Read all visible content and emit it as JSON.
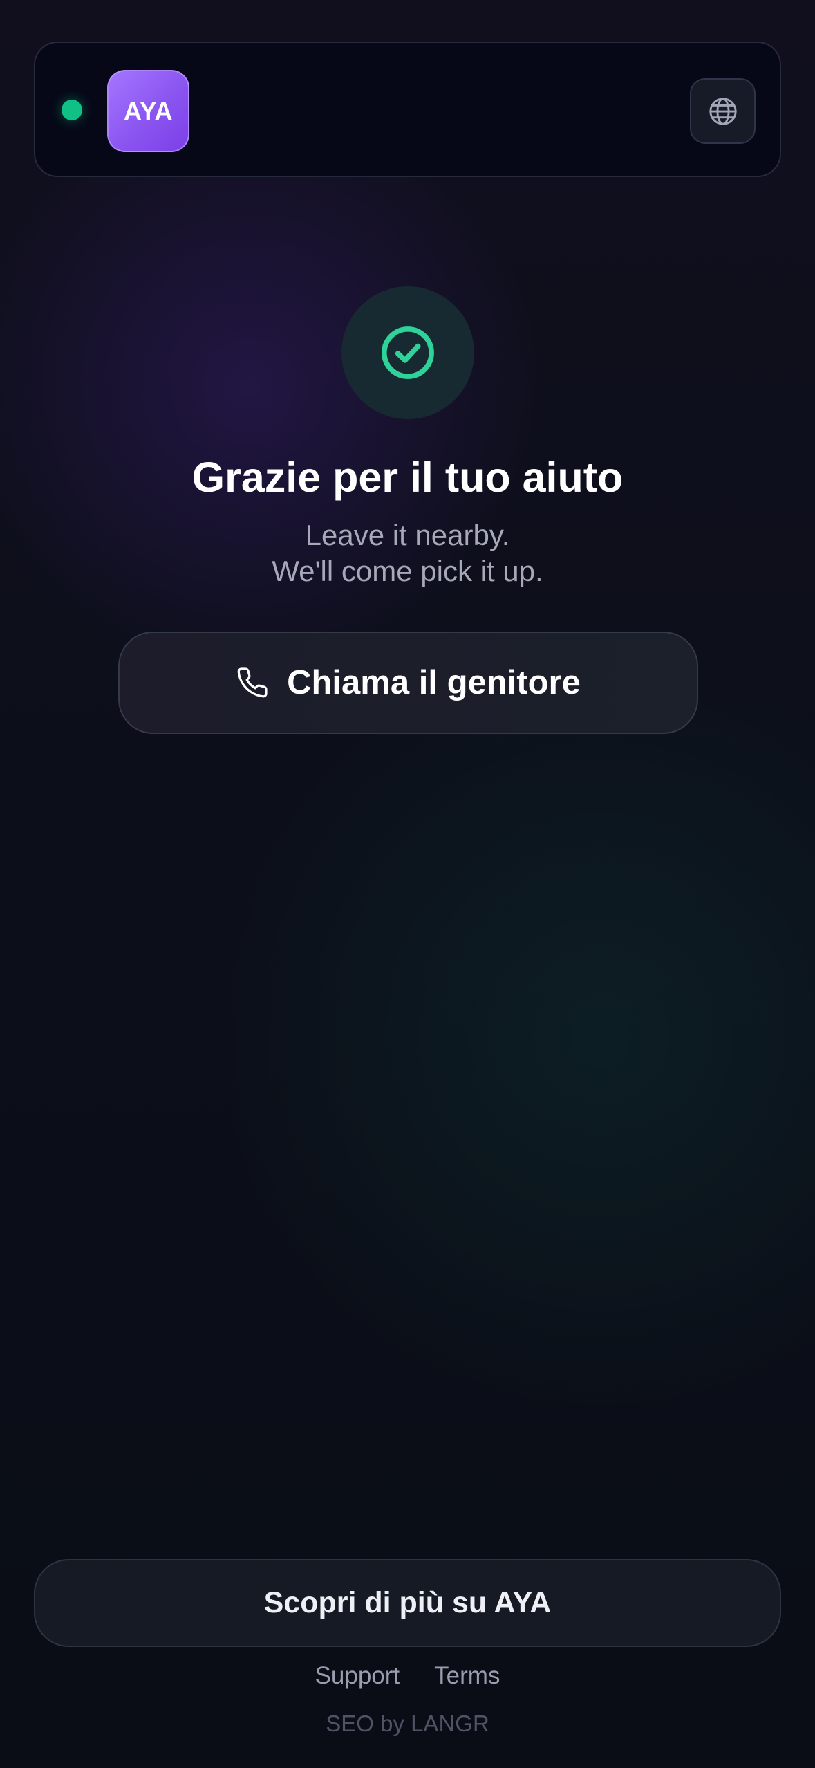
{
  "colors": {
    "accent_purple": "#8b55f0",
    "status_green": "#10c186",
    "background": "#0c0f1a"
  },
  "header": {
    "status": "online-indicator",
    "logo_text": "AYA",
    "language_icon": "globe-icon"
  },
  "main": {
    "success_icon": "check-circle-icon",
    "title": "Grazie per il tuo aiuto",
    "subtitle_line1": "Leave it nearby.",
    "subtitle_line2": "We'll come pick it up.",
    "call_button": {
      "icon": "phone-icon",
      "label": "Chiama il genitore"
    }
  },
  "footer": {
    "discover_label": "Scopri di più su AYA",
    "links": [
      "Support",
      "Terms"
    ],
    "credit": "SEO by LANGR"
  }
}
